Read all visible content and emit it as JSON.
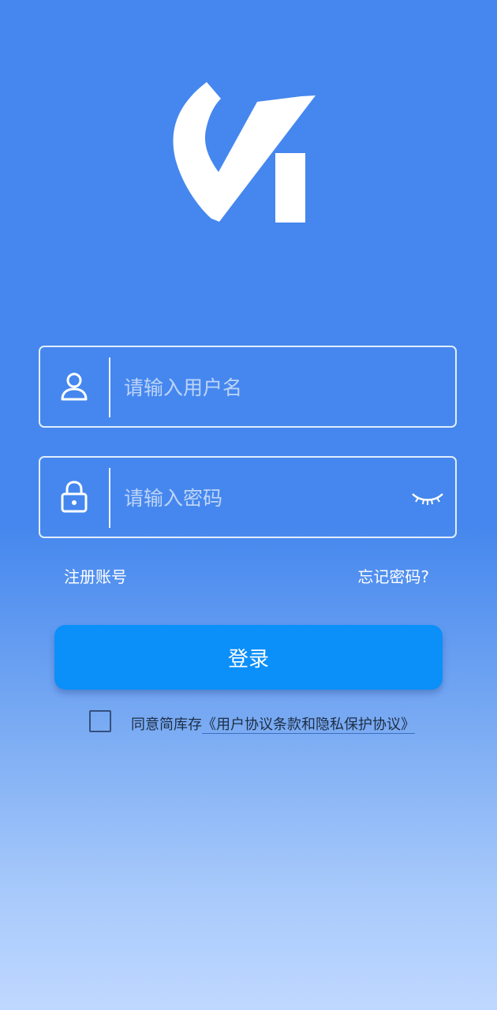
{
  "logo": {
    "name": "app-logo"
  },
  "login_form": {
    "username_placeholder": "请输入用户名",
    "username_icon": "user-icon",
    "password_placeholder": "请输入密码",
    "password_icon": "lock-icon",
    "password_toggle_icon": "eye-closed-icon"
  },
  "links": {
    "register": "注册账号",
    "forgot_password": "忘记密码?"
  },
  "login_button": "登录",
  "agreement": {
    "prefix": "同意简库存",
    "terms_link": "《用户协议条款和隐私保护协议》",
    "checked": false
  },
  "colors": {
    "background_top": "#4587ee",
    "background_bottom": "#bfd8ff",
    "button": "#0b8ff9"
  }
}
